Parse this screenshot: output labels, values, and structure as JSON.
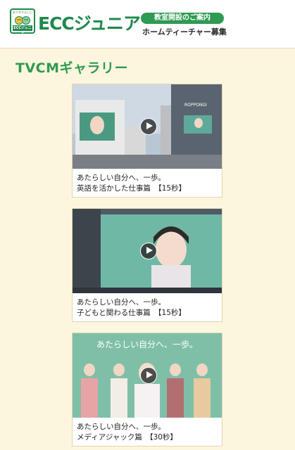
{
  "header": {
    "logo_tagline": "おうちでえいご",
    "logo_badge": "ECCジュニア",
    "logo_text": "ECCジュニア",
    "pill_label": "教室開設のご案内",
    "recruit_label": "ホームティーチャー募集"
  },
  "section": {
    "title": "TVCMギャラリー"
  },
  "videos": [
    {
      "line1": "あたらしい自分へ、一歩。",
      "line2": "英語を活かした仕事篇　【15秒】",
      "billboard_text": "ROPPONGI"
    },
    {
      "line1": "あたらしい自分へ、一歩。",
      "line2": "子どもと関わる仕事篇　【15秒】"
    },
    {
      "line1": "あたらしい自分へ、一歩。",
      "line2": "メディアジャック篇　【30秒】",
      "overlay_text": "あたらしい自分へ、一歩。"
    }
  ],
  "colors": {
    "brand_green": "#1f8a4c",
    "title_green": "#2f9a53",
    "page_bg": "#fdf6de"
  }
}
